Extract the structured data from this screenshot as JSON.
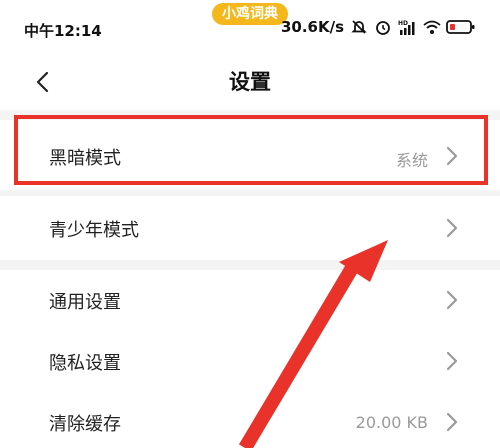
{
  "status_bar": {
    "time": "中午12:14",
    "app_tag": "小鸡词典",
    "speed": "30.6K/s",
    "icons": [
      "mute-bell-icon",
      "alarm-icon",
      "hd-signal-icon",
      "wifi-icon",
      "battery-icon"
    ]
  },
  "header": {
    "title": "设置",
    "back_icon": "chevron-left-icon"
  },
  "settings": {
    "items": [
      {
        "label": "黑暗模式",
        "value": "系统"
      },
      {
        "label": "青少年模式",
        "value": ""
      },
      {
        "label": "通用设置",
        "value": ""
      },
      {
        "label": "隐私设置",
        "value": ""
      },
      {
        "label": "清除缓存",
        "value": "20.00 KB"
      }
    ]
  },
  "colors": {
    "annotation_red": "#e8322a",
    "app_tag_bg": "#f5b81c",
    "section_gap": "#f4f4f4",
    "value_gray": "#9a9a9a",
    "chevron_gray": "#9a9a9a"
  }
}
